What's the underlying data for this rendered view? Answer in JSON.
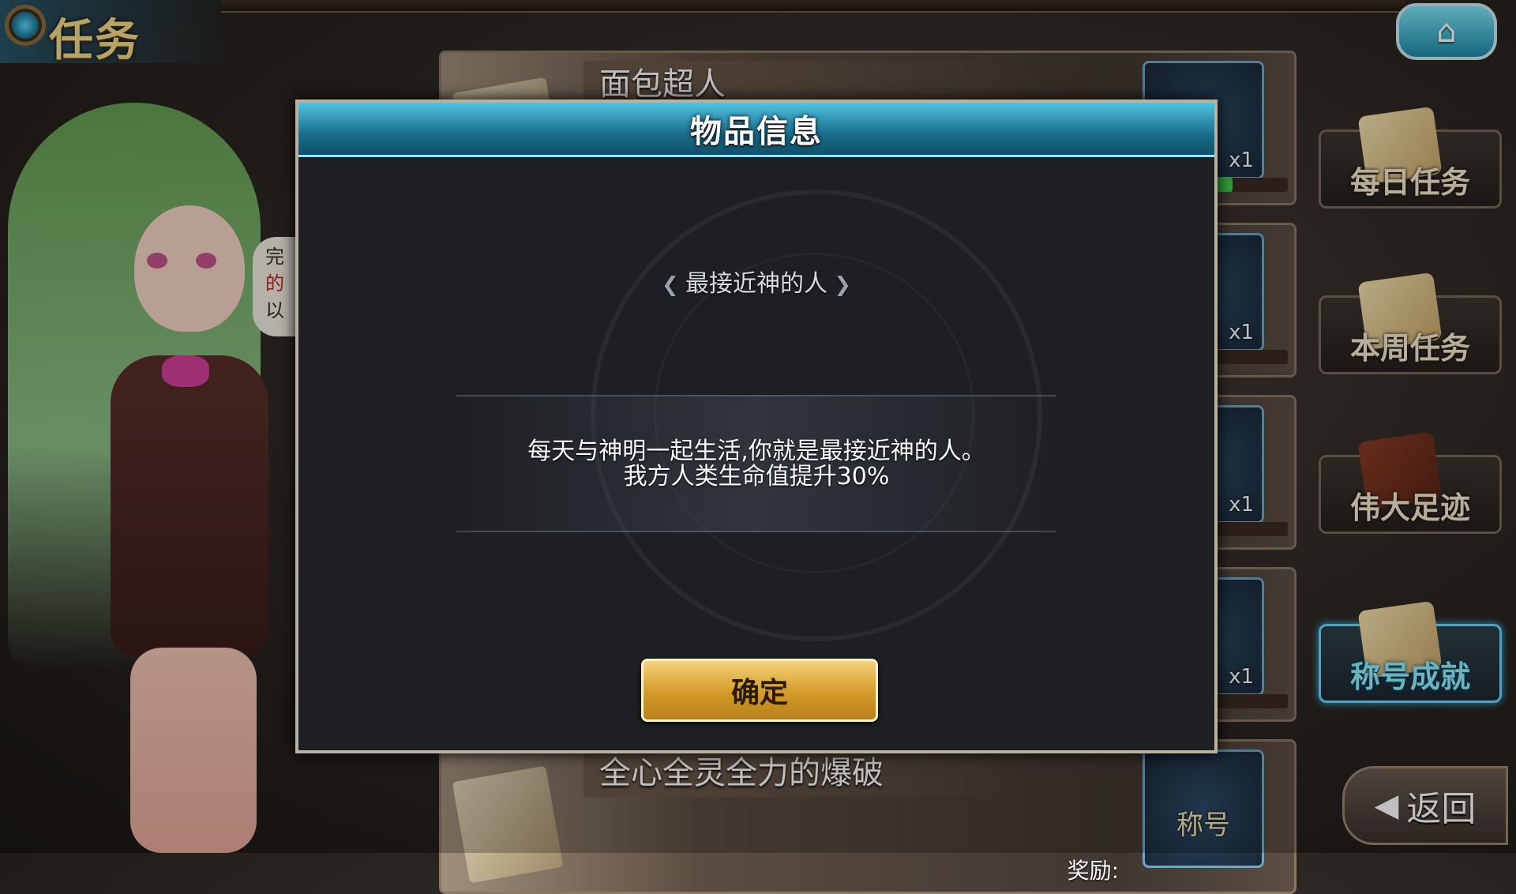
{
  "header": {
    "title": "任务",
    "home_icon": "home-icon"
  },
  "character": {
    "speech_lines": [
      "完",
      "的",
      "以"
    ]
  },
  "quests": [
    {
      "title": "面包超人",
      "reward_count": "x1",
      "has_progress": true
    },
    {
      "title": "",
      "reward_count": "x1",
      "has_progress": true
    },
    {
      "title": "",
      "reward_count": "x1",
      "has_progress": true
    },
    {
      "title": "",
      "reward_count": "x1",
      "has_progress": true
    },
    {
      "title": "全心全灵全力的爆破",
      "reward_label": "奖励:",
      "reward_badge": "称号"
    }
  ],
  "side_nav": [
    {
      "label": "每日任务",
      "active": false
    },
    {
      "label": "本周任务",
      "active": false
    },
    {
      "label": "伟大足迹",
      "active": false
    },
    {
      "label": "称号成就",
      "active": true
    }
  ],
  "back_button": {
    "label": "返回"
  },
  "modal": {
    "title": "物品信息",
    "item_name": "最接近神的人",
    "description_line1": "每天与神明一起生活,你就是最接近神的人。",
    "description_line2": "我方人类生命值提升30%",
    "confirm_label": "确定"
  },
  "colors": {
    "modal_header": "#1a6e8e",
    "confirm_button": "#d29a28",
    "active_nav": "#6cd9ff"
  }
}
